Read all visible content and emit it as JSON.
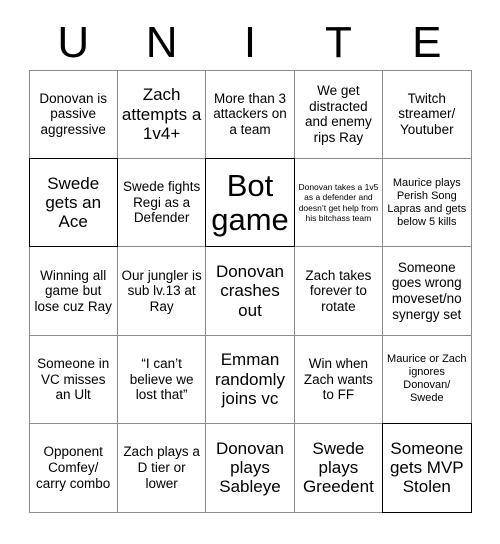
{
  "header": {
    "letters": [
      "U",
      "N",
      "I",
      "T",
      "E"
    ]
  },
  "grid": {
    "columns": 5,
    "rows": 5,
    "cells": [
      {
        "text": "Donovan is passive aggressive",
        "size": "md",
        "bold_border": false
      },
      {
        "text": "Zach attempts a 1v4+",
        "size": "lg",
        "bold_border": false
      },
      {
        "text": "More than 3 attackers on a team",
        "size": "md",
        "bold_border": false
      },
      {
        "text": "We get distracted and enemy rips Ray",
        "size": "md",
        "bold_border": false
      },
      {
        "text": "Twitch streamer/ Youtuber",
        "size": "md",
        "bold_border": false
      },
      {
        "text": "Swede gets an Ace",
        "size": "lg",
        "bold_border": true
      },
      {
        "text": "Swede fights Regi as a Defender",
        "size": "md",
        "bold_border": false
      },
      {
        "text": "Bot game",
        "size": "xl",
        "bold_border": true
      },
      {
        "text": "Donovan takes a 1v5 as a defender and doesn’t get help from his bitchass team",
        "size": "xs",
        "bold_border": false
      },
      {
        "text": "Maurice plays Perish Song Lapras and gets below 5 kills",
        "size": "sm",
        "bold_border": false
      },
      {
        "text": "Winning all game but lose cuz Ray",
        "size": "md",
        "bold_border": false
      },
      {
        "text": "Our jungler is sub lv.13 at Ray",
        "size": "md",
        "bold_border": false
      },
      {
        "text": "Donovan crashes out",
        "size": "lg",
        "bold_border": false
      },
      {
        "text": "Zach takes forever to rotate",
        "size": "md",
        "bold_border": false
      },
      {
        "text": "Someone goes wrong moveset/no synergy set",
        "size": "md",
        "bold_border": false
      },
      {
        "text": "Someone in VC misses an Ult",
        "size": "md",
        "bold_border": false
      },
      {
        "text": "“I can’t believe we lost that”",
        "size": "md",
        "bold_border": false
      },
      {
        "text": "Emman randomly joins vc",
        "size": "lg",
        "bold_border": false
      },
      {
        "text": "Win when Zach wants to FF",
        "size": "md",
        "bold_border": false
      },
      {
        "text": "Maurice or Zach ignores Donovan/ Swede",
        "size": "sm",
        "bold_border": false
      },
      {
        "text": "Opponent Comfey/ carry combo",
        "size": "md",
        "bold_border": false
      },
      {
        "text": "Zach plays a D tier or lower",
        "size": "md",
        "bold_border": false
      },
      {
        "text": "Donovan plays Sableye",
        "size": "lg",
        "bold_border": false
      },
      {
        "text": "Swede plays Greedent",
        "size": "lg",
        "bold_border": false
      },
      {
        "text": "Someone gets MVP Stolen",
        "size": "lg",
        "bold_border": true
      }
    ]
  }
}
